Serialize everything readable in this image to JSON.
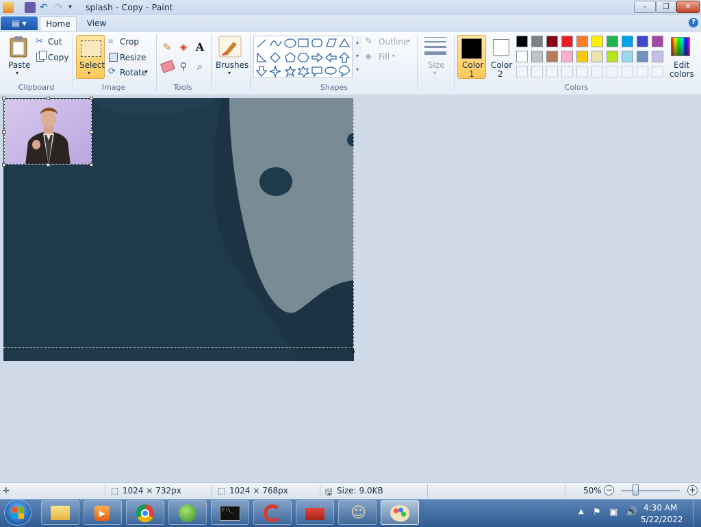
{
  "window": {
    "title": "splash - Copy - Paint",
    "minimize": "–",
    "maximize": "❐",
    "close": "✕"
  },
  "tabs": {
    "app_menu": "▤ ▾",
    "home": "Home",
    "view": "View",
    "help": "?"
  },
  "ribbon": {
    "clipboard": {
      "paste": "Paste",
      "cut": "Cut",
      "copy": "Copy",
      "label": "Clipboard"
    },
    "image": {
      "select": "Select",
      "crop": "Crop",
      "resize": "Resize",
      "rotate": "Rotate",
      "label": "Image"
    },
    "tools": {
      "label": "Tools"
    },
    "brushes": {
      "label": "Brushes"
    },
    "shapes": {
      "label": "Shapes",
      "outline": "Outline",
      "fill": "Fill"
    },
    "size": {
      "label": "Size"
    },
    "colors": {
      "label": "Colors",
      "color1": "Color",
      "color1_num": "1",
      "color2": "Color",
      "color2_num": "2",
      "edit": "Edit",
      "edit2": "colors",
      "color1_value": "#000000",
      "color2_value": "#ffffff",
      "palette_row1": [
        "#000000",
        "#7f7f7f",
        "#880015",
        "#ed1c24",
        "#ff7f27",
        "#fff200",
        "#22b14c",
        "#00a2e8",
        "#3f48cc",
        "#a349a4"
      ],
      "palette_row2": [
        "#ffffff",
        "#c3c3c3",
        "#b97a57",
        "#ffaec9",
        "#ffc90e",
        "#efe4b0",
        "#b5e61d",
        "#99d9ea",
        "#7092be",
        "#c8bfe7"
      ]
    }
  },
  "status": {
    "selection_size": "1024 × 732px",
    "image_size": "1024 × 768px",
    "file_size": "Size: 9.0KB",
    "zoom": "50%"
  },
  "taskbar": {
    "time": "4:30 AM",
    "date": "5/22/2022"
  }
}
